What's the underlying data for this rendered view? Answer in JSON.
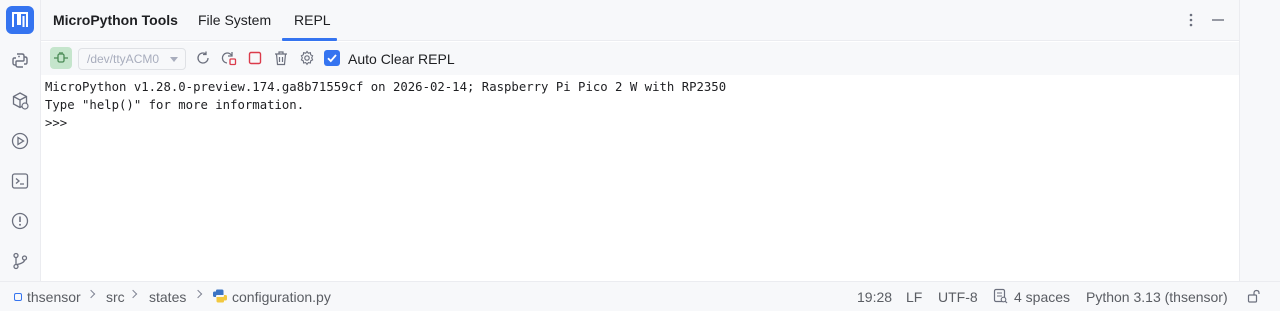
{
  "header": {
    "title": "MicroPython Tools",
    "tabs": [
      {
        "label": "File System",
        "active": false
      },
      {
        "label": "REPL",
        "active": true
      }
    ],
    "accent_color": "#3574f0"
  },
  "toolbar": {
    "port_select": {
      "value": "/dev/ttyACM0",
      "disabled": true
    },
    "auto_clear_checkbox": {
      "label": "Auto Clear REPL",
      "checked": true
    },
    "buttons": [
      "connect-icon",
      "refresh-icon",
      "reset-icon",
      "stop-icon",
      "trash-icon",
      "gear-icon"
    ]
  },
  "console": {
    "lines": [
      "MicroPython v1.28.0-preview.174.ga8b71559cf on 2026-02-14; Raspberry Pi Pico 2 W with RP2350",
      "Type \"help()\" for more information.",
      ">>>"
    ]
  },
  "left_strip_icons": [
    "micropython-logo",
    "python-icon",
    "packages-icon",
    "run-icon",
    "terminal-icon",
    "problems-icon",
    "git-icon"
  ],
  "statusbar": {
    "breadcrumb": [
      "thsensor",
      "src",
      "states",
      "configuration.py"
    ],
    "position": "19:28",
    "line_separator": "LF",
    "encoding": "UTF-8",
    "indent": "4 spaces",
    "interpreter": "Python 3.13 (thsensor)"
  }
}
